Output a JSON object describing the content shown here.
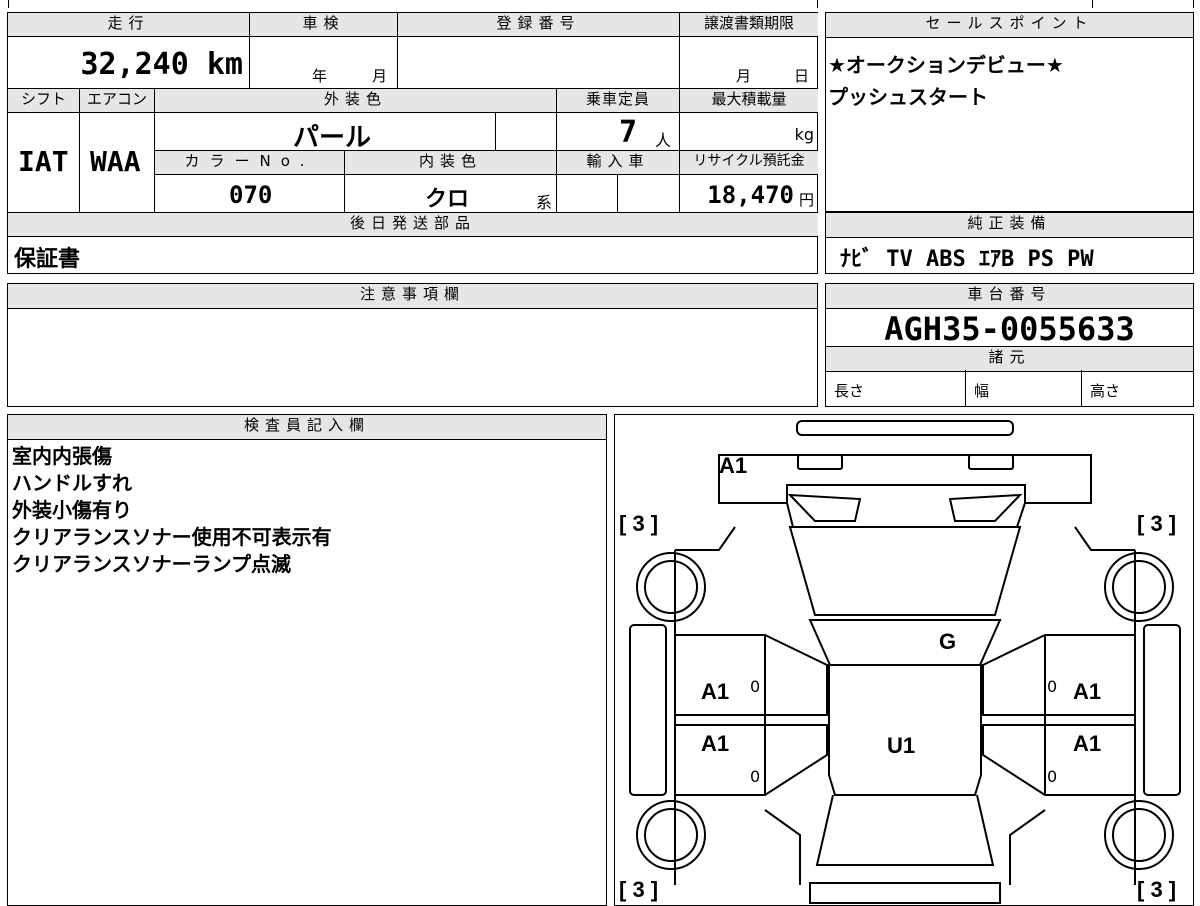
{
  "top_table": {
    "mileage_label": "走行",
    "mileage_value": "32,240 km",
    "inspection_label": "車検",
    "inspection_year": "年",
    "inspection_month": "月",
    "registration_label": "登録番号",
    "transfer_deadline_label": "譲渡書類期限",
    "transfer_month": "月",
    "transfer_day": "日",
    "shift_label": "シフト",
    "shift_value": "IAT",
    "aircon_label": "エアコン",
    "aircon_value": "WAA",
    "exterior_color_label": "外装色",
    "exterior_color_value": "パール",
    "capacity_label": "乗車定員",
    "capacity_value": "7",
    "capacity_unit": "人",
    "max_load_label": "最大積載量",
    "max_load_unit": "kg",
    "color_no_label": "カラーNo.",
    "color_no_value": "070",
    "interior_color_label": "内装色",
    "interior_color_value": "クロ",
    "interior_color_suffix": "系",
    "import_label": "輸入車",
    "recycle_label": "リサイクル預託金",
    "recycle_value": "18,470",
    "recycle_unit": "円",
    "later_shipping_label": "後日発送部品",
    "later_shipping_value": "保証書"
  },
  "sales_point": {
    "label": "セールスポイント",
    "lines": [
      "★オークションデビュー★",
      "プッシュスタート"
    ]
  },
  "standard_equipment": {
    "label": "純正装備",
    "value": "ﾅﾋﾞ TV ABS ｴｱB PS PW"
  },
  "notes": {
    "label": "注意事項欄"
  },
  "chassis": {
    "label": "車台番号",
    "value": "AGH35-0055633",
    "specs_label": "諸元",
    "length_label": "長さ",
    "width_label": "幅",
    "height_label": "高さ"
  },
  "inspector": {
    "label": "検査員記入欄",
    "lines": [
      "室内内張傷",
      "ハンドルすれ",
      "外装小傷有り",
      "クリアランスソナー使用不可表示有",
      "クリアランスソナーランプ点滅"
    ]
  },
  "diagram": {
    "front_bumper": "A1",
    "tire_fl": "[ 3 ]",
    "tire_fr": "[ 3 ]",
    "tire_rl": "[ 3 ]",
    "tire_rr": "[ 3 ]",
    "windshield": "G",
    "door_fl": "A1",
    "door_fl_sub": "0",
    "door_rl": "A1",
    "door_rl_sub": "0",
    "door_fr": "A1",
    "door_fr_sub": "0",
    "door_rr": "A1",
    "door_rr_sub": "0",
    "roof": "U1"
  }
}
